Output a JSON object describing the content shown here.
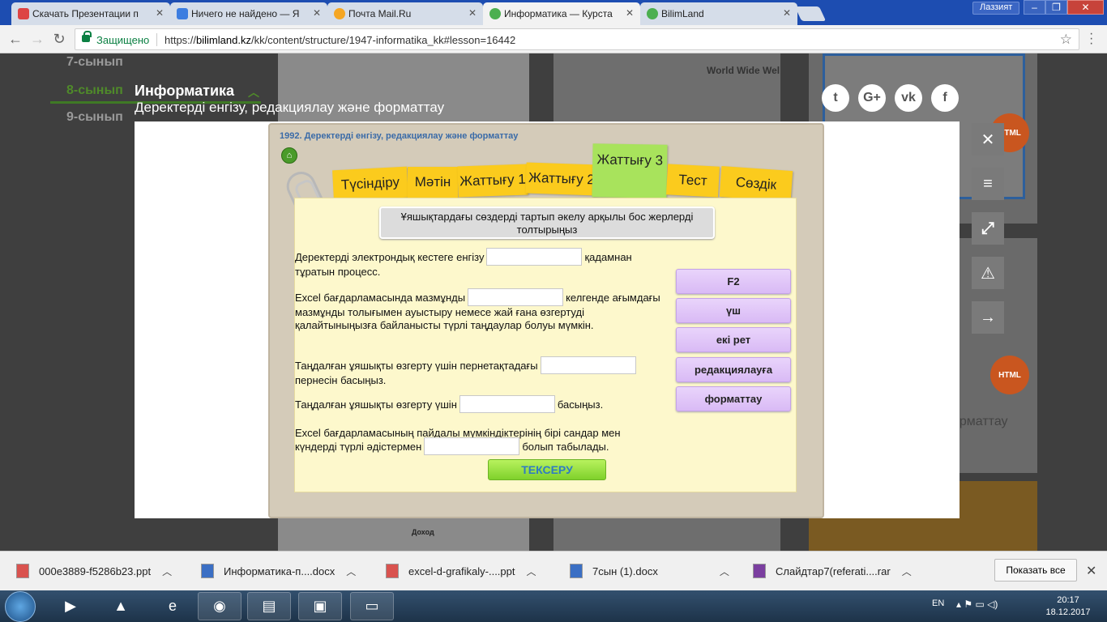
{
  "browser": {
    "tabs": [
      {
        "title": "Скачать Презентации п",
        "active": false,
        "icon_color": "#d44"
      },
      {
        "title": "Ничего не найдено — Я",
        "active": false,
        "icon_color": "#3c7de0"
      },
      {
        "title": "Почта Mail.Ru",
        "active": false,
        "icon_color": "#f5a623"
      },
      {
        "title": "Информатика — Курста",
        "active": true,
        "icon_color": "#4caf50"
      },
      {
        "title": "BilimLand",
        "active": false,
        "icon_color": "#4caf50"
      }
    ],
    "user": "Лаззият",
    "secure_label": "Защищено",
    "url_prefix": "https://",
    "url_host": "bilimland.kz",
    "url_path": "/kk/content/structure/1947-informatika_kk#lesson=16442"
  },
  "page": {
    "grades": [
      "7-сынып",
      "8-сынып",
      "9-сынып"
    ],
    "subject": "Информатика",
    "topic": "Деректерді енгізу, редакциялау және форматтау",
    "background_text_1": "World Wide Wel",
    "background_text_2": "орматтау",
    "background_text_3": "Доход"
  },
  "lesson": {
    "title": "1992. Деректерді енгізу, редакциялау және форматтау",
    "tabs": [
      "Түсіндіру",
      "Мәтін",
      "Жаттығу 1",
      "Жаттығу 2",
      "Жаттығу 3",
      "Тест",
      "Сөздік"
    ],
    "active_tab": "Жаттығу 3",
    "instruction": "Ұяшықтардағы сөздерді тартып әкелу арқылы бос жерлерді толтырыңыз",
    "questions": [
      {
        "before": "Деректерді электрондық кестеге енгізу",
        "after": "қадамнан тұратын процесс."
      },
      {
        "before": "Excel бағдарламасында мазмұнды",
        "after": "келгенде ағымдағы мазмұнды толығымен ауыстыру немесе жай ғана өзгертуді қалайтыныңызға байланысты түрлі таңдаулар болуы мүмкін."
      },
      {
        "before": "Таңдалған ұяшықты өзгерту үшін пернетақтадағы",
        "after": "пернесін басыңыз."
      },
      {
        "before": "Таңдалған ұяшықты өзгерту үшін",
        "after": "басыңыз."
      },
      {
        "before": "Excel бағдарламасының пайдалы мүмкіндіктерінің бірі сандар мен күндерді түрлі әдістермен",
        "after": "болып табылады."
      }
    ],
    "options": [
      "F2",
      "үш",
      "екі рет",
      "редакциялауға",
      "форматтау"
    ],
    "check_button": "ТЕКСЕРУ"
  },
  "downloads": {
    "items": [
      "000e3889-f5286b23.ppt",
      "Информатика-п....docx",
      "excel-d-grafikaly-....ppt",
      "7сын (1).docx",
      "Слайдтар7(referati....rar"
    ],
    "show_all": "Показать все"
  },
  "taskbar": {
    "lang": "EN",
    "time": "20:17",
    "date": "18.12.2017"
  }
}
